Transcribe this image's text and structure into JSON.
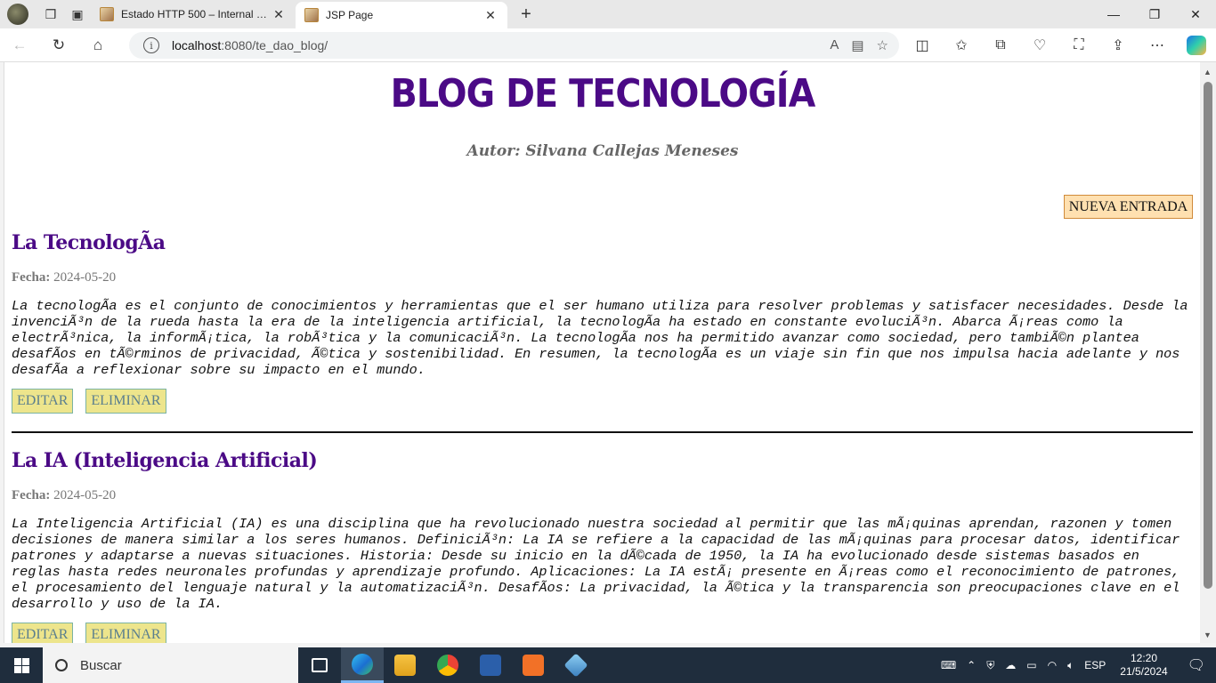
{
  "browser": {
    "tabs": [
      {
        "title": "Estado HTTP 500 – Internal Server Error",
        "active": false
      },
      {
        "title": "JSP Page",
        "active": true
      }
    ],
    "address": {
      "host": "localhost",
      "path": ":8080/te_dao_blog/"
    }
  },
  "page": {
    "title": "BLOG DE TECNOLOGÍA",
    "author": "Autor: Silvana Callejas Meneses",
    "new_entry_label": "NUEVA ENTRADA",
    "posts": [
      {
        "title": "La TecnologÃa",
        "date_label": "Fecha:",
        "date": "2024-05-20",
        "content": "La tecnologÃa es el conjunto de conocimientos y herramientas que el ser humano utiliza para resolver problemas y satisfacer necesidades. Desde la invenciÃ³n de la rueda hasta la era de la inteligencia artificial, la tecnologÃa ha estado en constante evoluciÃ³n. Abarca Ã¡reas como la electrÃ³nica, la informÃ¡tica, la robÃ³tica y la comunicaciÃ³n. La tecnologÃa nos ha permitido avanzar como sociedad, pero tambiÃ©n plantea desafÃos en tÃ©rminos de privacidad, Ã©tica y sostenibilidad. En resumen, la tecnologÃa es un viaje sin fin que nos impulsa hacia adelante y nos desafÃa a reflexionar sobre su impacto en el mundo.",
        "edit_label": "EDITAR",
        "delete_label": "ELIMINAR"
      },
      {
        "title": "La IA (Inteligencia Artificial)",
        "date_label": "Fecha:",
        "date": "2024-05-20",
        "content": "La Inteligencia Artificial (IA) es una disciplina que ha revolucionado nuestra sociedad al permitir que las mÃ¡quinas aprendan, razonen y tomen decisiones de manera similar a los seres humanos. DefiniciÃ³n: La IA se refiere a la capacidad de las mÃ¡quinas para procesar datos, identificar patrones y adaptarse a nuevas situaciones. Historia: Desde su inicio en la dÃ©cada de 1950, la IA ha evolucionado desde sistemas basados en reglas hasta redes neuronales profundas y aprendizaje profundo. Aplicaciones: La IA estÃ¡ presente en Ã¡reas como el reconocimiento de patrones, el procesamiento del lenguaje natural y la automatizaciÃ³n. DesafÃos: La privacidad, la Ã©tica y la transparencia son preocupaciones clave en el desarrollo y uso de la IA.",
        "edit_label": "EDITAR",
        "delete_label": "ELIMINAR"
      }
    ]
  },
  "taskbar": {
    "search_placeholder": "Buscar",
    "language": "ESP",
    "time": "12:20",
    "date": "21/5/2024"
  }
}
